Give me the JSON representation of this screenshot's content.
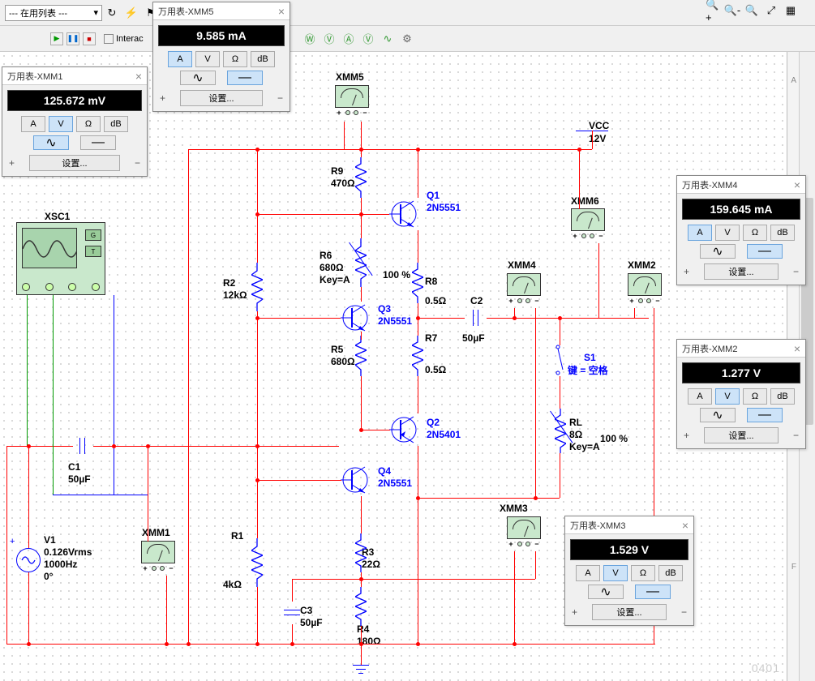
{
  "toolbar": {
    "dropdown_label": "--- 在用列表 ---",
    "interact_label": "Interac",
    "icons_right": [
      "zoom-in",
      "zoom-out",
      "zoom-reset",
      "zoom-fit",
      "grid"
    ]
  },
  "multimeters": {
    "xmm1": {
      "title": "万用表-XMM1",
      "value": "125.672 mV",
      "mode": "V",
      "wave": "ac",
      "set": "设置..."
    },
    "xmm5": {
      "title": "万用表-XMM5",
      "value": "9.585 mA",
      "mode": "A",
      "wave": "dc",
      "set": "设置..."
    },
    "xmm4": {
      "title": "万用表-XMM4",
      "value": "159.645 mA",
      "mode": "A",
      "wave": "dc",
      "set": "设置..."
    },
    "xmm2": {
      "title": "万用表-XMM2",
      "value": "1.277 V",
      "mode": "V",
      "wave": "dc",
      "set": "设置..."
    },
    "xmm3": {
      "title": "万用表-XMM3",
      "value": "1.529 V",
      "mode": "V",
      "wave": "dc",
      "set": "设置..."
    },
    "btn_A": "A",
    "btn_V": "V",
    "btn_O": "Ω",
    "btn_dB": "dB"
  },
  "components": {
    "xsc1": "XSC1",
    "xmm5": "XMM5",
    "xmm6": "XMM6",
    "xmm4c": "XMM4",
    "xmm2c": "XMM2",
    "xmm3c": "XMM3",
    "xmm1c": "XMM1",
    "vcc": "VCC",
    "vcc_val": "12V",
    "r9": "R9",
    "r9v": "470Ω",
    "r6": "R6",
    "r6v": "680Ω",
    "r6k": "Key=A",
    "r6p": "100 %",
    "r5": "R5",
    "r5v": "680Ω",
    "r2": "R2",
    "r2v": "12kΩ",
    "r1": "R1",
    "r1v": "4kΩ",
    "r3": "R3",
    "r3v": "22Ω",
    "r4": "R4",
    "r4v": "180Ω",
    "r8": "R8",
    "r8v": "0.5Ω",
    "r7": "R7",
    "r7v": "0.5Ω",
    "rl": "RL",
    "rlv": "8Ω",
    "rlk": "Key=A",
    "rlp": "100 %",
    "c1": "C1",
    "c1v": "50µF",
    "c2": "C2",
    "c2v": "50µF",
    "c3": "C3",
    "c3v": "50µF",
    "q1": "Q1",
    "q1t": "2N5551",
    "q2": "Q2",
    "q2t": "2N5401",
    "q3": "Q3",
    "q3t": "2N5551",
    "q4": "Q4",
    "q4t": "2N5551",
    "s1": "S1",
    "s1k": "键 = 空格",
    "v1": "V1",
    "v1a": "0.126Vrms",
    "v1b": "1000Hz",
    "v1c": "0°"
  },
  "ruler": {
    "a": "A",
    "f": "F"
  },
  "watermark": "0401"
}
